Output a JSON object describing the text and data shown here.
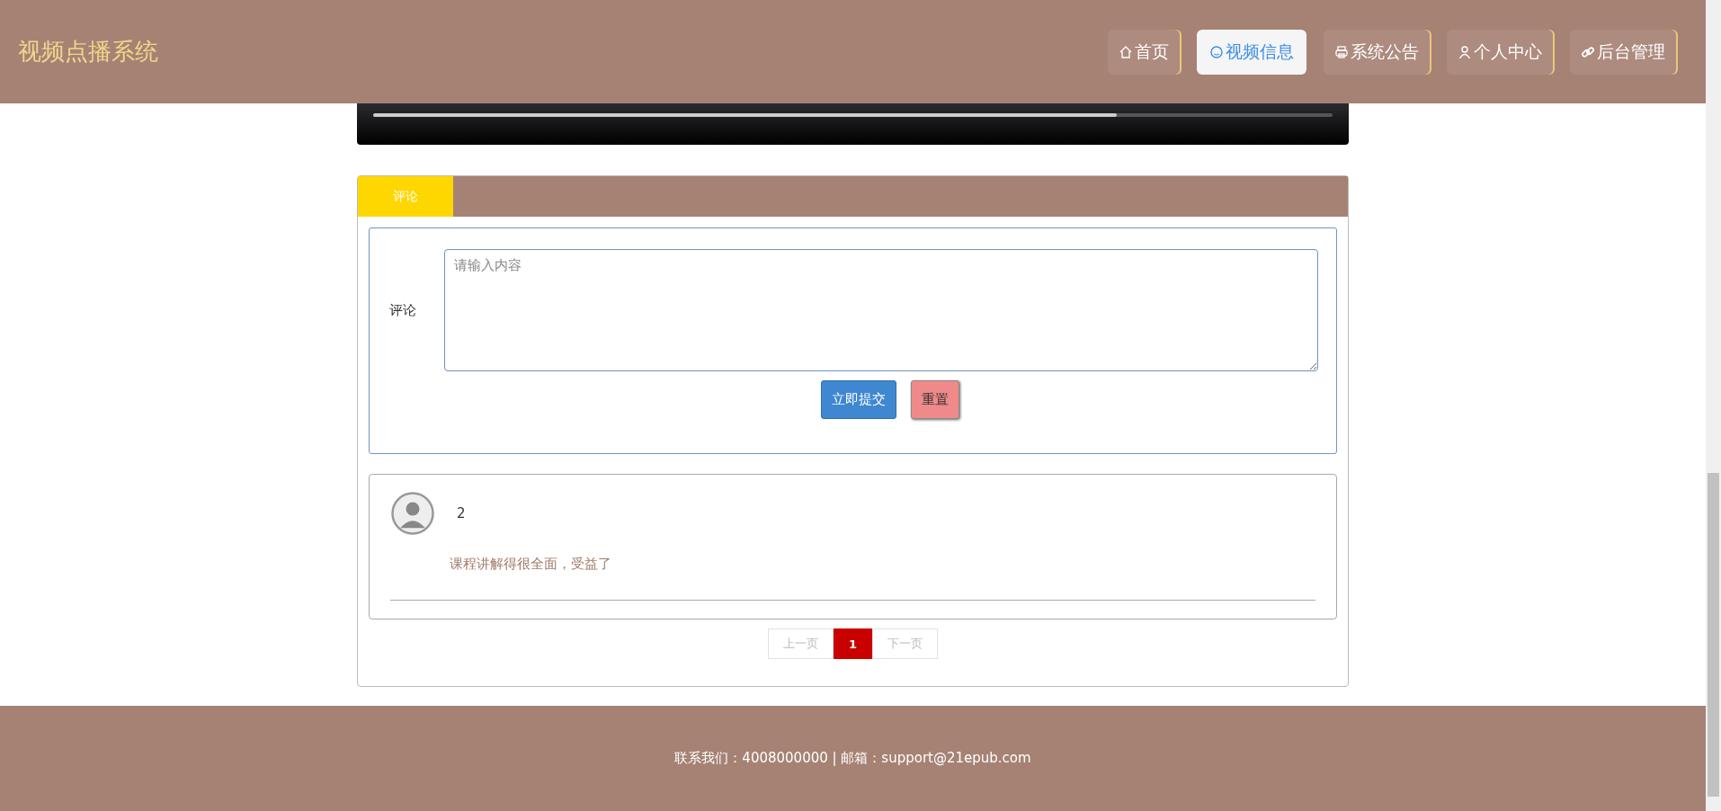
{
  "header": {
    "title": "视频点播系统",
    "nav": [
      {
        "label": "首页",
        "kind": "home",
        "selected": false
      },
      {
        "label": "视频信息",
        "kind": "video",
        "selected": true
      },
      {
        "label": "系统公告",
        "kind": "printer",
        "selected": false
      },
      {
        "label": "个人中心",
        "kind": "user",
        "selected": false
      },
      {
        "label": "后台管理",
        "kind": "link",
        "selected": false
      }
    ]
  },
  "player": {
    "progress": {
      "level": 0.775
    }
  },
  "comments": {
    "tabs": [
      {
        "label": "评论",
        "selected": true
      }
    ],
    "form": {
      "label": "评论",
      "placeholder": "请输入内容",
      "buttons": [
        {
          "label": "立即提交",
          "kind": "primary"
        },
        {
          "label": "重置",
          "kind": "reset"
        }
      ]
    },
    "items": [
      {
        "user": "2",
        "text": "课程讲解得很全面，受益了"
      }
    ],
    "pagination": {
      "prev": "上一页",
      "pages": [
        {
          "label": "1",
          "selected": true
        }
      ],
      "next": "下一页"
    }
  },
  "footer": {
    "text": "联系我们：4008000000 | 邮箱：support@21epub.com"
  }
}
